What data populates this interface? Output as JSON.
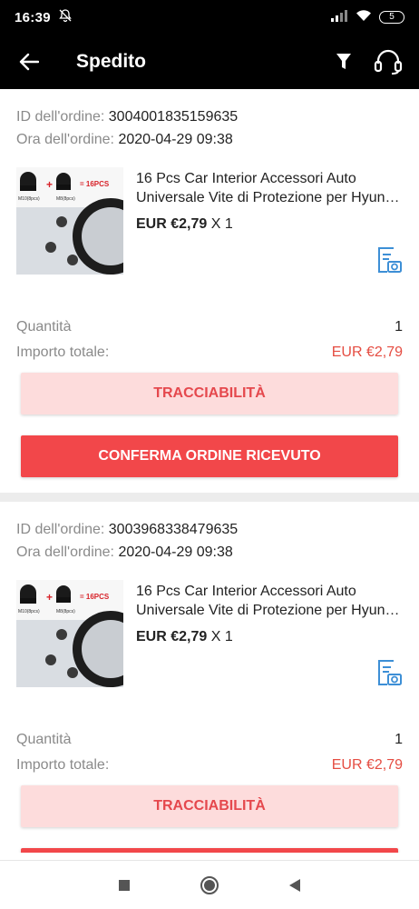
{
  "status_bar": {
    "time": "16:39",
    "battery": "5"
  },
  "app_bar": {
    "title": "Spedito"
  },
  "orders": [
    {
      "id_label": "ID dell'ordine:",
      "id": "3004001835159635",
      "time_label": "Ora dell'ordine:",
      "time": "2020-04-29 09:38",
      "product_title_line1": "16 Pcs Car Interior Accessori Auto",
      "product_title_line2": "Universale Vite di Protezione per Hyundai",
      "price": "EUR €2,79",
      "qty_suffix": "X 1",
      "thumb_caption": "= 16PCS",
      "thumb_label_a": "M10(8pcs)",
      "thumb_label_b": "M8(8pcs)",
      "quantity_label": "Quantità",
      "quantity": "1",
      "total_label": "Importo totale:",
      "total": "EUR €2,79",
      "track_label": "TRACCIABILITÀ",
      "confirm_label": "CONFERMA ORDINE RICEVUTO"
    },
    {
      "id_label": "ID dell'ordine:",
      "id": "3003968338479635",
      "time_label": "Ora dell'ordine:",
      "time": "2020-04-29 09:38",
      "product_title_line1": "16 Pcs Car Interior Accessori Auto",
      "product_title_line2": "Universale Vite di Protezione per Hyundai",
      "price": "EUR €2,79",
      "qty_suffix": "X 1",
      "thumb_caption": "= 16PCS",
      "thumb_label_a": "M10(8pcs)",
      "thumb_label_b": "M8(8pcs)",
      "quantity_label": "Quantità",
      "quantity": "1",
      "total_label": "Importo totale:",
      "total": "EUR €2,79",
      "track_label": "TRACCIABILITÀ"
    }
  ],
  "colors": {
    "accent": "#f2474a",
    "track_bg": "#fddcdc",
    "total": "#e54d42",
    "icon_blue": "#3d8fd6"
  }
}
